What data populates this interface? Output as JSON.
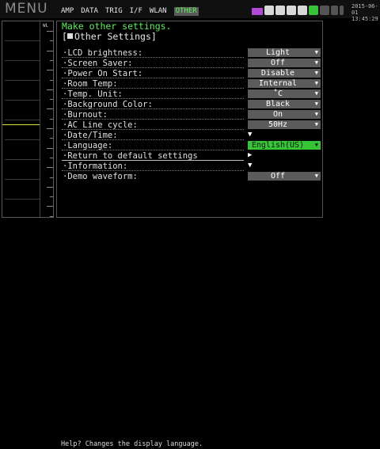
{
  "header": {
    "menu_title": "MENU",
    "tabs": [
      {
        "label": "AMP",
        "active": false
      },
      {
        "label": "DATA",
        "active": false
      },
      {
        "label": "TRIG",
        "active": false
      },
      {
        "label": "I/F",
        "active": false
      },
      {
        "label": "WLAN",
        "active": false
      },
      {
        "label": "OTHER",
        "active": true
      }
    ],
    "clock_date": "2015-06-01",
    "clock_time": "13:45:29",
    "status_icons": [
      "wl-icon",
      "card-icon",
      "card-icon",
      "card-icon",
      "card-icon",
      "card-green-icon",
      "usb-icon",
      "battery-icon",
      "plug-icon"
    ]
  },
  "side": {
    "label": "WL"
  },
  "main": {
    "heading": "Make other settings.",
    "section_title": "Other Settings]",
    "section_prefix": "[",
    "rows": [
      {
        "label": "·LCD brightness:",
        "value": "Light",
        "kind": "select"
      },
      {
        "label": "·Screen Saver:",
        "value": "Off",
        "kind": "select"
      },
      {
        "label": "·Power On Start:",
        "value": "Disable",
        "kind": "select"
      },
      {
        "label": "·Room Temp:",
        "value": "Internal",
        "kind": "select"
      },
      {
        "label": "·Temp. Unit:",
        "value": "˚C",
        "kind": "select"
      },
      {
        "label": "·Background Color:",
        "value": "Black",
        "kind": "select"
      },
      {
        "label": "·Burnout:",
        "value": "On",
        "kind": "select"
      },
      {
        "label": "·AC Line cycle:",
        "value": "50Hz",
        "kind": "select"
      },
      {
        "label": "·Date/Time:",
        "value": "▼",
        "kind": "trigger"
      },
      {
        "label": "·Language:",
        "value": "English(US)",
        "kind": "select-active"
      },
      {
        "label": "·Return to default settings",
        "value": "▶",
        "kind": "trigger"
      },
      {
        "label": "·Information:",
        "value": "▼",
        "kind": "trigger"
      },
      {
        "label": "·Demo waveform:",
        "value": "Off",
        "kind": "select"
      }
    ]
  },
  "footer": {
    "help": "Help?  Changes the display language."
  },
  "colors": {
    "accent_green": "#5df05d",
    "select_grey": "#5b5b5b",
    "active_green": "#35c535",
    "wl_purple": "#b04bd6"
  }
}
